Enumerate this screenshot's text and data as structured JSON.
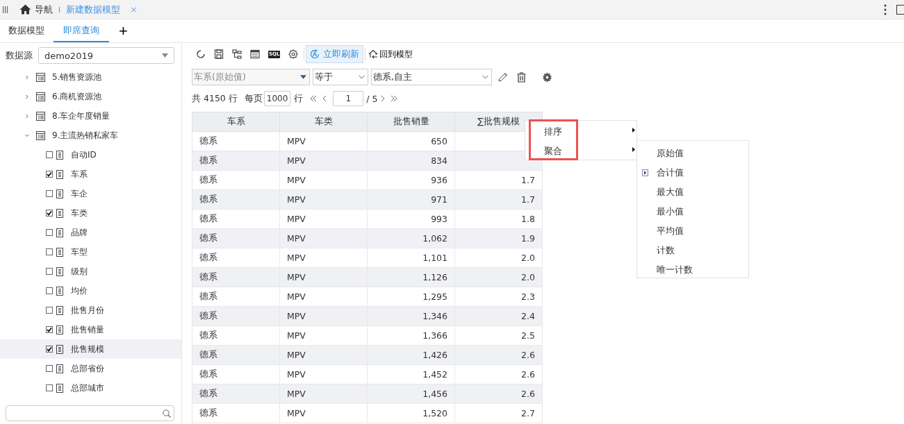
{
  "top_bar": {
    "nav_label": "导航",
    "doc_tab": "新建数据模型",
    "close": "×"
  },
  "tabs": [
    {
      "label": "数据模型",
      "selected": false
    },
    {
      "label": "即席查询",
      "selected": true
    }
  ],
  "add_tab": "+",
  "datasource": {
    "label": "数据源",
    "value": "demo2019"
  },
  "tree": [
    {
      "label": "5.销售资源池",
      "expanded": false
    },
    {
      "label": "6.商机资源池",
      "expanded": false
    },
    {
      "label": "8.车企年度销量",
      "expanded": false
    },
    {
      "label": "9.主流热销私家车",
      "expanded": true,
      "children": [
        {
          "label": "自动ID",
          "checked": false,
          "selected": false
        },
        {
          "label": "车系",
          "checked": true,
          "selected": false
        },
        {
          "label": "车企",
          "checked": false,
          "selected": false
        },
        {
          "label": "车类",
          "checked": true,
          "selected": false
        },
        {
          "label": "品牌",
          "checked": false,
          "selected": false
        },
        {
          "label": "车型",
          "checked": false,
          "selected": false
        },
        {
          "label": "级别",
          "checked": false,
          "selected": false
        },
        {
          "label": "均价",
          "checked": false,
          "selected": false
        },
        {
          "label": "批售月份",
          "checked": false,
          "selected": false
        },
        {
          "label": "批售销量",
          "checked": true,
          "selected": false
        },
        {
          "label": "批售规模",
          "checked": true,
          "selected": true
        },
        {
          "label": "总部省份",
          "checked": false,
          "selected": false
        },
        {
          "label": "总部城市",
          "checked": false,
          "selected": false
        }
      ]
    }
  ],
  "toolbar": {
    "refresh_label": "立即刷新",
    "refresh_on": true,
    "sql_label": "SQL",
    "back_label": "回到模型"
  },
  "filter": {
    "field": "车系(原始值)",
    "operator": "等于",
    "value": "德系,自主"
  },
  "pager": {
    "total": "共 4150 行",
    "per_page_label": "每页",
    "per_page": "1000",
    "row_unit": "行",
    "page": "1",
    "page_count": "/ 5"
  },
  "table": {
    "columns": [
      {
        "label": "车系",
        "kind": "text"
      },
      {
        "label": "车类",
        "kind": "text"
      },
      {
        "label": "批售销量",
        "kind": "number"
      },
      {
        "label": "∑批售规模",
        "kind": "number"
      }
    ],
    "rows": [
      [
        "德系",
        "MPV",
        "650",
        null
      ],
      [
        "德系",
        "MPV",
        "834",
        null
      ],
      [
        "德系",
        "MPV",
        "936",
        "1.7"
      ],
      [
        "德系",
        "MPV",
        "971",
        "1.7"
      ],
      [
        "德系",
        "MPV",
        "993",
        "1.8"
      ],
      [
        "德系",
        "MPV",
        "1,062",
        "1.9"
      ],
      [
        "德系",
        "MPV",
        "1,101",
        "2.0"
      ],
      [
        "德系",
        "MPV",
        "1,126",
        "2.0"
      ],
      [
        "德系",
        "MPV",
        "1,295",
        "2.3"
      ],
      [
        "德系",
        "MPV",
        "1,346",
        "2.4"
      ],
      [
        "德系",
        "MPV",
        "1,366",
        "2.5"
      ],
      [
        "德系",
        "MPV",
        "1,426",
        "2.6"
      ],
      [
        "德系",
        "MPV",
        "1,452",
        "2.6"
      ],
      [
        "德系",
        "MPV",
        "1,456",
        "2.6"
      ],
      [
        "德系",
        "MPV",
        "1,520",
        "2.7"
      ]
    ]
  },
  "context_menu": {
    "items": [
      {
        "label": "排序",
        "has_submenu": true
      },
      {
        "label": "聚合",
        "has_submenu": true
      }
    ],
    "highlighted": true
  },
  "submenu": {
    "items": [
      {
        "label": "原始值",
        "selected": false
      },
      {
        "label": "合计值",
        "selected": true
      },
      {
        "label": "最大值",
        "selected": false
      },
      {
        "label": "最小值",
        "selected": false
      },
      {
        "label": "平均值",
        "selected": false
      },
      {
        "label": "计数",
        "selected": false
      },
      {
        "label": "唯一计数",
        "selected": false
      }
    ]
  }
}
